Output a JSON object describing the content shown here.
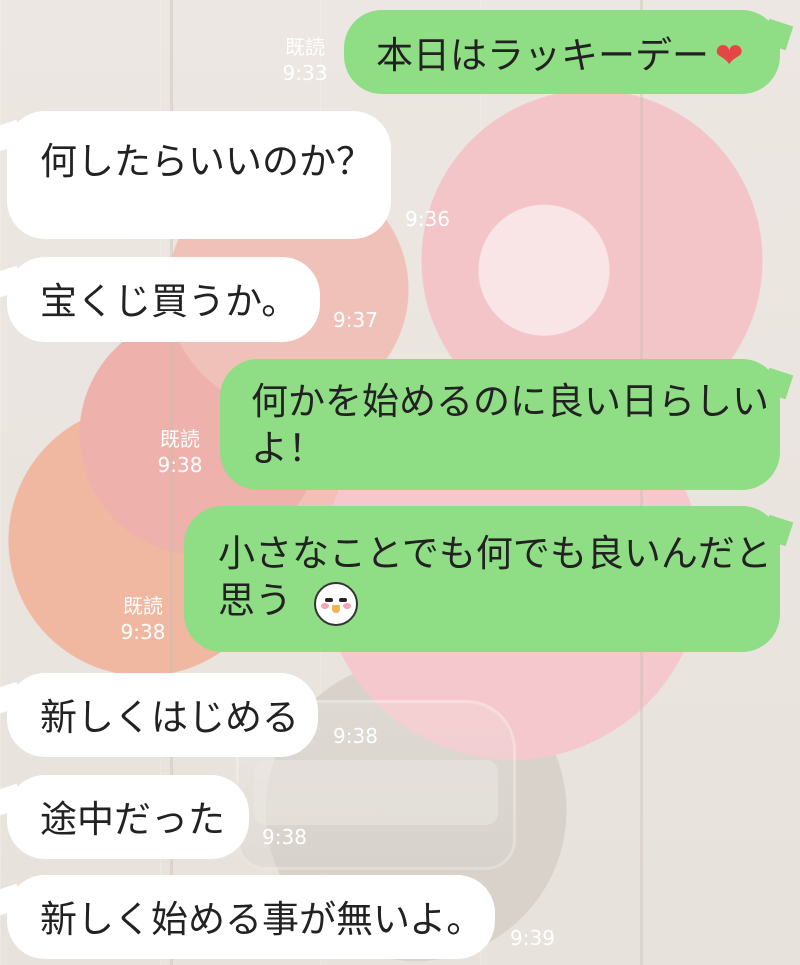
{
  "chat": {
    "messages": [
      {
        "text": "本日はラッキーデー"
      },
      {
        "text": "何したらいいのか？"
      },
      {
        "text": "宝くじ買うか。"
      },
      {
        "line1": "何かを始めるのに良い日らしい",
        "line2": "よ！"
      },
      {
        "line1": "小さなことでも何でも良いんだと",
        "line2": "思う"
      },
      {
        "text": "新しくはじめる"
      },
      {
        "text": "途中だった"
      },
      {
        "text": "新しく始める事が無いよ。"
      }
    ],
    "status": {
      "read": "既読",
      "times": [
        "9:33",
        "9:36",
        "9:37",
        "9:38",
        "9:38",
        "9:38",
        "9:38",
        "9:39"
      ]
    },
    "icons": {
      "heart": "heart-icon",
      "face": "bird-face-icon"
    },
    "colors": {
      "outgoing": "#8fdd84",
      "incoming": "#ffffff",
      "meta": "#ffffff",
      "heart": "#e44545"
    }
  }
}
